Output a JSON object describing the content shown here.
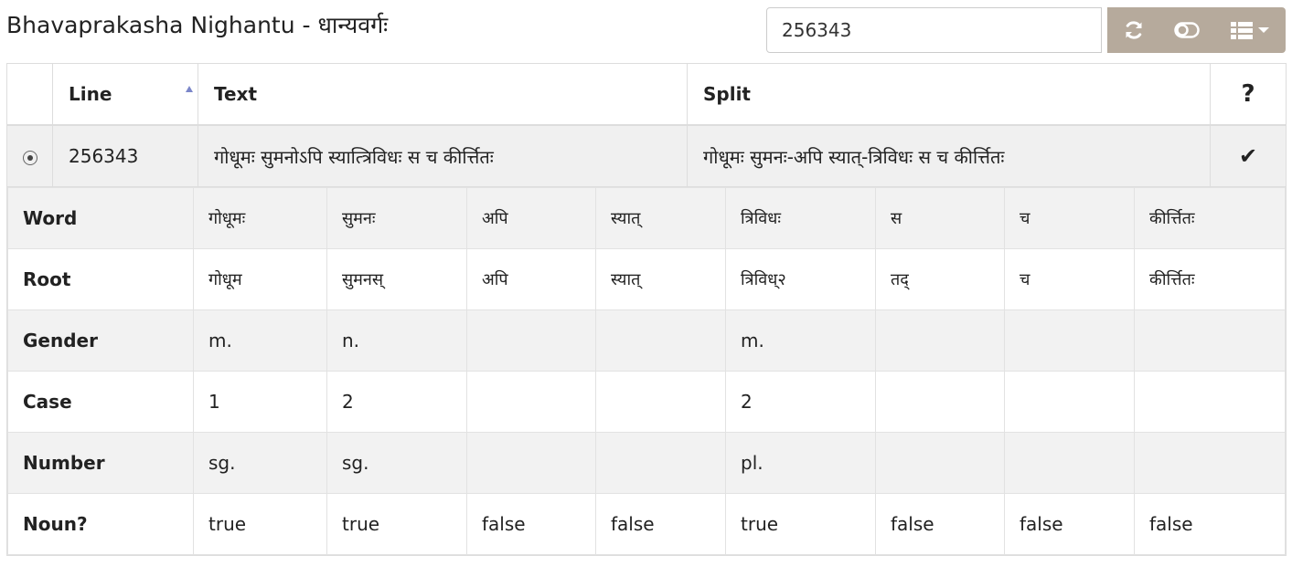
{
  "header": {
    "title": "Bhavaprakasha Nighantu - धान्यवर्गः",
    "search_value": "256343",
    "toolbar": [
      {
        "icon": "refresh-icon"
      },
      {
        "icon": "toggle-icon"
      },
      {
        "icon": "list-columns-icon",
        "caret": true
      }
    ]
  },
  "table": {
    "columns": {
      "line": "Line",
      "text": "Text",
      "split": "Split",
      "help": "?"
    },
    "sort": {
      "column": "line",
      "direction": "asc"
    },
    "selected_row": {
      "line": "256343",
      "text": "गोधूमः सुमनोऽपि स्यात्त्रिविधः स च कीर्त्तितः",
      "split": "गोधूमः सुमनः-अपि स्यात्-त्रिविधः स च कीर्त्तितः",
      "status": "✔"
    },
    "detail": {
      "rows": [
        {
          "label": "Word",
          "values": [
            "गोधूमः",
            "सुमनः",
            "अपि",
            "स्यात्",
            "त्रिविधः",
            "स",
            "च",
            "कीर्त्तितः"
          ]
        },
        {
          "label": "Root",
          "values": [
            "गोधूम",
            "सुमनस्",
            "अपि",
            "स्यात्",
            "त्रिविध्२",
            "तद्",
            "च",
            "कीर्त्तितः"
          ]
        },
        {
          "label": "Gender",
          "values": [
            "m.",
            "n.",
            "",
            "",
            "m.",
            "",
            "",
            ""
          ]
        },
        {
          "label": "Case",
          "values": [
            "1",
            "2",
            "",
            "",
            "2",
            "",
            "",
            ""
          ]
        },
        {
          "label": "Number",
          "values": [
            "sg.",
            "sg.",
            "",
            "",
            "pl.",
            "",
            "",
            ""
          ]
        },
        {
          "label": "Noun?",
          "values": [
            "true",
            "true",
            "false",
            "false",
            "true",
            "false",
            "false",
            "false"
          ]
        }
      ]
    }
  }
}
